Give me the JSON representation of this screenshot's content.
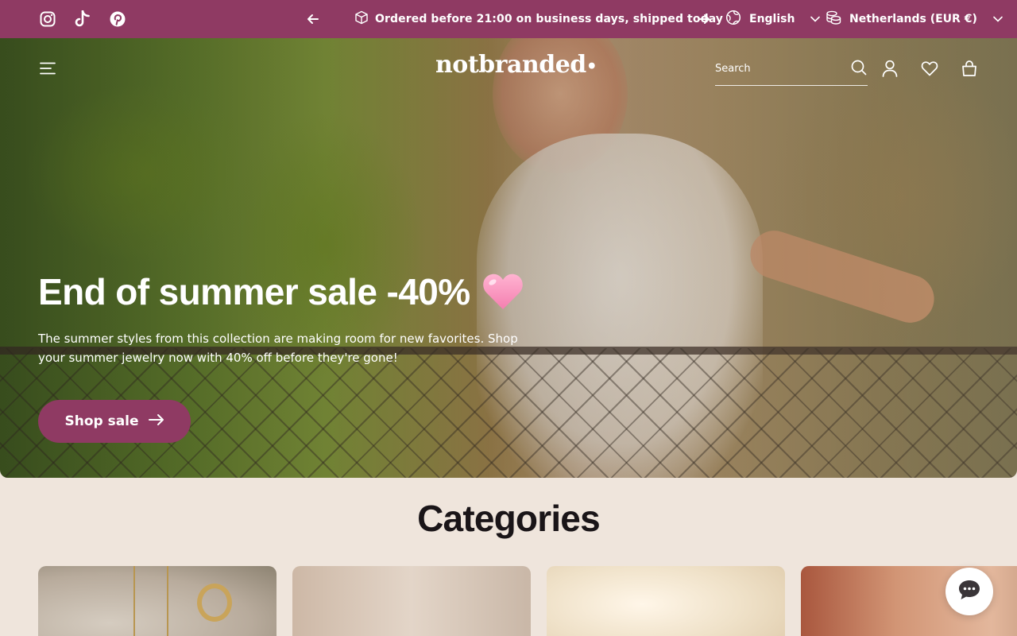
{
  "announcement": {
    "socials": [
      "instagram-icon",
      "tiktok-icon",
      "pinterest-icon"
    ],
    "message": "Ordered before 21:00 on business days, shipped today",
    "language": "English",
    "country": "Netherlands (EUR €)"
  },
  "header": {
    "logo": "notbranded",
    "search_placeholder": "Search"
  },
  "hero": {
    "title": "End of summer sale -40%",
    "text": "The summer styles from this collection are making room for new favorites. Shop your summer jewelry now with 40% off before they're gone!",
    "button_label": "Shop sale"
  },
  "categories": {
    "heading": "Categories"
  },
  "colors": {
    "brand": "#8f3a63",
    "background": "#efe5dc"
  }
}
